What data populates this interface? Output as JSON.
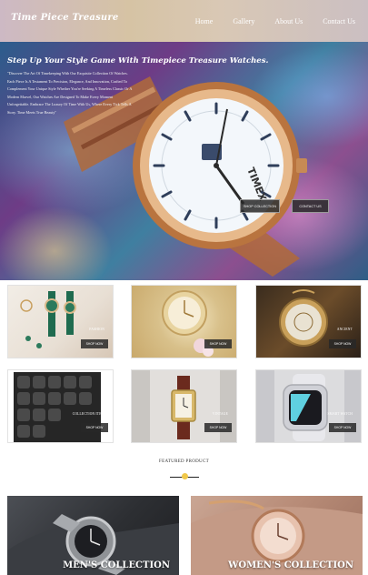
{
  "header": {
    "brand": "Time Piece Treasure",
    "nav": [
      "Home",
      "Gallery",
      "About Us",
      "Contact Us"
    ]
  },
  "hero": {
    "title": "Step Up Your Style Game With Timepiece Treasure Watches.",
    "text": "\"Discover The Art Of Timekeeping With Our Exquisite Collection Of Watches. Each Piece Is A Testament To Precision, Elegance, And Innovation, Crafted To Complement Your Unique Style Whether You're Seeking A Timeless Classic Or A Modern Marvel, Our Watches Are Designed To Make Every Moment Unforgettable. Embrace The Luxury Of Time With Us, Where Every Tick Tells A Story. Time Meets True Beauty\"",
    "watch_brand": "TIMEX",
    "buttons": {
      "shop": "SHOP COLLECTION",
      "contact": "CONTACT US"
    }
  },
  "cards": [
    {
      "label": "FASHION",
      "button": "SHOP NOW"
    },
    {
      "label": "",
      "button": "SHOP NOW"
    },
    {
      "label": "ANCIENT",
      "button": "SHOP NOW"
    },
    {
      "label": "COLLECTION ITEM",
      "button": "SHOP NOW"
    },
    {
      "label": "VINTAGE",
      "button": "SHOP NOW"
    },
    {
      "label": "SMART WATCH",
      "button": "SHOP NOW"
    }
  ],
  "featured": {
    "title": "FEATURED PRODUCT",
    "accent": "#f0c84a"
  },
  "collections": {
    "men": "MEN'S COLLECTION",
    "women": "WOMEN'S COLLECTION"
  }
}
